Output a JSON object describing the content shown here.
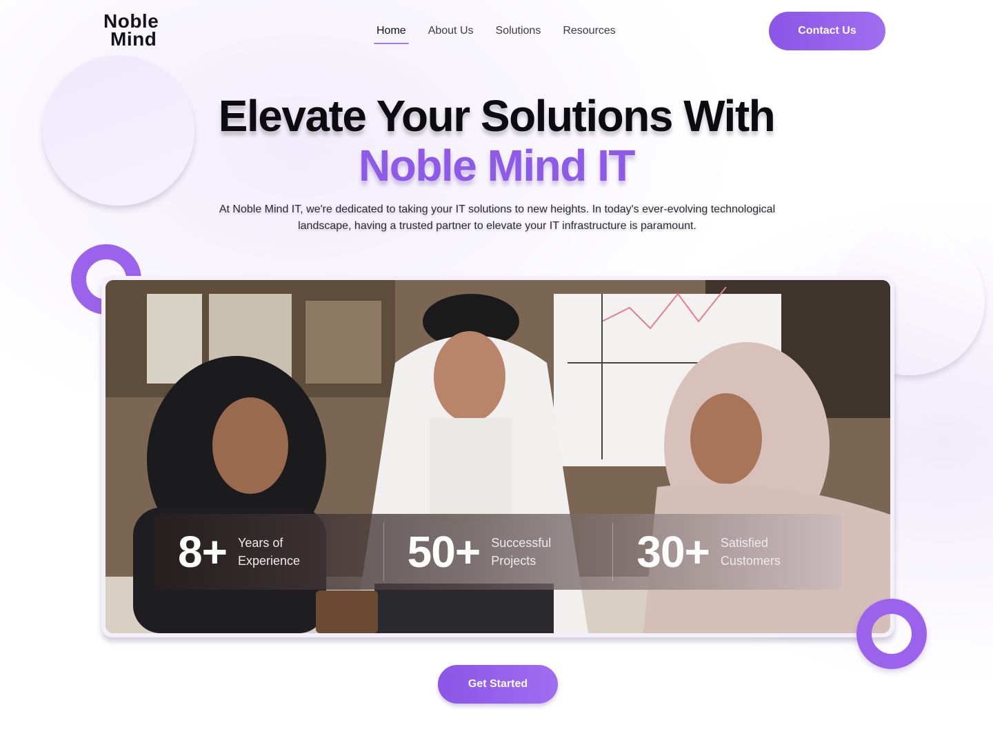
{
  "header": {
    "logo_line1": "Noble",
    "logo_line2": "Mind",
    "nav": [
      "Home",
      "About Us",
      "Solutions",
      "Resources"
    ],
    "active_nav": "Home",
    "contact_label": "Contact Us"
  },
  "hero": {
    "title_line1": "Elevate Your Solutions With",
    "title_line2": "Noble Mind IT",
    "description": "At Noble Mind IT, we're dedicated to taking your IT solutions to new heights. In today's ever-evolving technological landscape, having a trusted partner to elevate your IT infrastructure is paramount."
  },
  "stats": [
    {
      "number": "8+",
      "label": "Years of Experience"
    },
    {
      "number": "50+",
      "label": "Successful Projects"
    },
    {
      "number": "30+",
      "label": "Satisfied Customers"
    }
  ],
  "cta_label": "Get Started",
  "colors": {
    "accent": "#8e5ae8",
    "button": "#9b63ec",
    "text": "#0c0b10"
  }
}
